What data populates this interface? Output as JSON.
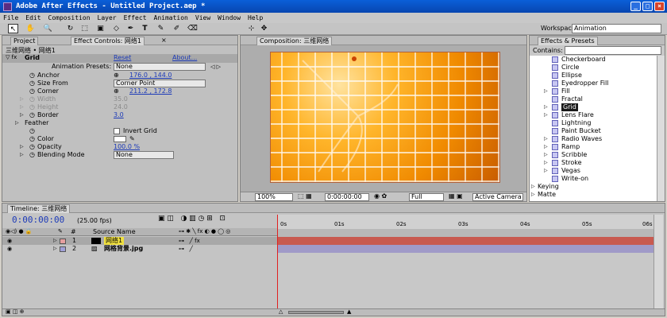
{
  "window": {
    "title": "Adobe After Effects - Untitled Project.aep *",
    "min": "_",
    "max": "□",
    "close": "×"
  },
  "menu": [
    "File",
    "Edit",
    "Composition",
    "Layer",
    "Effect",
    "Animation",
    "View",
    "Window",
    "Help"
  ],
  "toolbar": {
    "tools": [
      "↖",
      "✋",
      "🔍",
      "↻",
      "⬚",
      "▣",
      "◇",
      "✒",
      "T",
      "✎",
      "✐",
      "⌫",
      "⊹",
      "✥"
    ],
    "workspace_label": "Workspace:",
    "workspace_value": "Animation"
  },
  "left_panel": {
    "tabs": [
      "Project",
      "Effect Controls: 网络1",
      "×"
    ],
    "breadcrumb": "三维网络 • 网络1",
    "effect_name": "Grid",
    "reset": "Reset",
    "about": "About...",
    "presets_label": "Animation Presets:",
    "presets_value": "None",
    "properties": [
      {
        "name": "Anchor",
        "value": "176.0 , 144.0",
        "link": true,
        "icon": "crosshair-icon"
      },
      {
        "name": "Size From",
        "value": "Corner Point",
        "dropdown": true
      },
      {
        "name": "Corner",
        "value": "211.2 , 172.8",
        "link": true,
        "icon": "crosshair-icon"
      },
      {
        "name": "Width",
        "value": "35.0",
        "disabled": true
      },
      {
        "name": "Height",
        "value": "24.0",
        "disabled": true
      },
      {
        "name": "Border",
        "value": "3.0",
        "link": true
      }
    ],
    "feather": "Feather",
    "invert_label": "Invert Grid",
    "color_label": "Color",
    "opacity": {
      "name": "Opacity",
      "value": "100.0 %"
    },
    "blending": {
      "name": "Blending Mode",
      "value": "None"
    }
  },
  "comp_panel": {
    "tab": "Composition: 三维网络",
    "zoom": "100%",
    "timecode": "0:00:00:00",
    "resolution": "Full",
    "camera": "Active Camera"
  },
  "effects_panel": {
    "tab": "Effects & Presets",
    "contains_label": "Contains:",
    "items": [
      {
        "name": "Checkerboard",
        "expand": false
      },
      {
        "name": "Circle",
        "expand": false
      },
      {
        "name": "Ellipse",
        "expand": false
      },
      {
        "name": "Eyedropper Fill",
        "expand": false
      },
      {
        "name": "Fill",
        "expand": true
      },
      {
        "name": "Fractal",
        "expand": false
      },
      {
        "name": "Grid",
        "expand": true,
        "selected": true
      },
      {
        "name": "Lens Flare",
        "expand": true
      },
      {
        "name": "Lightning",
        "expand": false
      },
      {
        "name": "Paint Bucket",
        "expand": false
      },
      {
        "name": "Radio Waves",
        "expand": true
      },
      {
        "name": "Ramp",
        "expand": true
      },
      {
        "name": "Scribble",
        "expand": true
      },
      {
        "name": "Stroke",
        "expand": true
      },
      {
        "name": "Vegas",
        "expand": true
      },
      {
        "name": "Write-on",
        "expand": false
      }
    ],
    "groups": [
      "Keying",
      "Matte"
    ]
  },
  "timeline": {
    "tab": "Timeline: 三维网络",
    "timecode": "0:00:00:00",
    "fps": "(25.00 fps)",
    "col_num": "#",
    "col_source": "Source Name",
    "layers": [
      {
        "num": "1",
        "name": "网络1",
        "color": "#e6a0a0",
        "selected": true
      },
      {
        "num": "2",
        "name": "网格背景.jpg",
        "color": "#a0a0d8",
        "selected": false
      }
    ],
    "ruler": [
      "0s",
      "01s",
      "02s",
      "03s",
      "04s",
      "05s",
      "06s"
    ],
    "colors": {
      "bar1": "#c85a50",
      "bar2": "#a09ac8"
    }
  }
}
